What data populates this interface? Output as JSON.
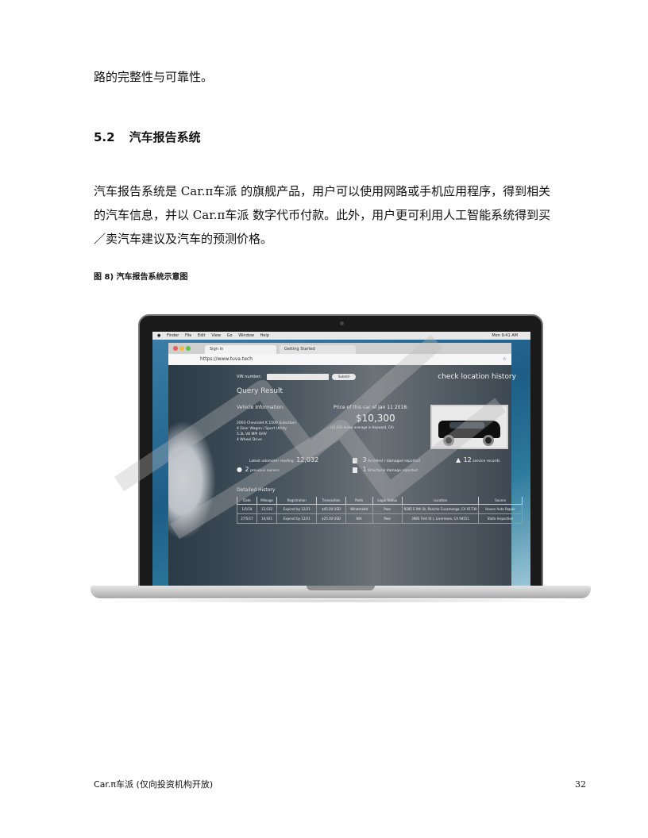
{
  "top_line": "路的完整性与可靠性。",
  "section": {
    "number": "5.2",
    "title": "汽车报告系统"
  },
  "body_lines": [
    "汽车报告系统是 Car.π车派 的旗舰产品，用户可以使用网路或手机应用程序，得到相关",
    "的汽车信息，并以 Car.π车派 数字代币付款。此外，用户更可利用人工智能系统得到买",
    "／卖汽车建议及汽车的预测价格。"
  ],
  "figure_caption": "图 8) 汽车报告系统示意图",
  "screen": {
    "menubar": [
      "Finder",
      "File",
      "Edit",
      "View",
      "Go",
      "Window",
      "Help"
    ],
    "clock": "Mon 9:41 AM",
    "tabs": [
      "Sign in",
      "Getting Started"
    ],
    "url": "https://www.tuva.tech",
    "vin_label": "VIN number:",
    "submit_label": "Submit",
    "location_link": "check location history",
    "query_title": "Query Result",
    "vehicle_label": "Vehicle Information:",
    "vehicle_desc": [
      "2003 Chevrolet K 1500 Suburban",
      "4 Door Wagon / Sport Utility",
      "5.3L V8 MPI OHV",
      "4 Wheel Drive"
    ],
    "price_label": "Price of this car of Jan 11 2018:",
    "price": "$10,300",
    "price_note": "($1,000 below average in Hayward, CA)",
    "stats": {
      "odometer_label": "Latest odometer reading",
      "odometer_value": "12,032",
      "owners_value": "2",
      "owners_label": "previous owners",
      "accident_value": "3",
      "accident_label": "Accident / damaged reported",
      "structural_value": "1",
      "structural_label": "Structural damage reported",
      "service_value": "12",
      "service_label": "service records"
    },
    "history_title": "Detailed History",
    "history_columns": [
      "Date",
      "Mileage",
      "Registration",
      "Transaction",
      "Parts",
      "Legal Status",
      "Location",
      "Source"
    ],
    "history_rows": [
      [
        "1/5/18",
        "12,032",
        "Expired by 12/21",
        "$45.00 USD",
        "Windshield",
        "Pass",
        "9285 E 9th St, Rancho Cucamonga, CA 91730",
        "Haven Auto Repair"
      ],
      [
        "27/5/17",
        "10,921",
        "Expired by 12/21",
        "$25.00 USD",
        "N/A",
        "Pass",
        "3985 First St (, Livermore, CA 94551",
        "State Inspection"
      ]
    ]
  },
  "footer": {
    "left": "Car.π车派 (仅向投资机构开放)",
    "page": "32"
  }
}
